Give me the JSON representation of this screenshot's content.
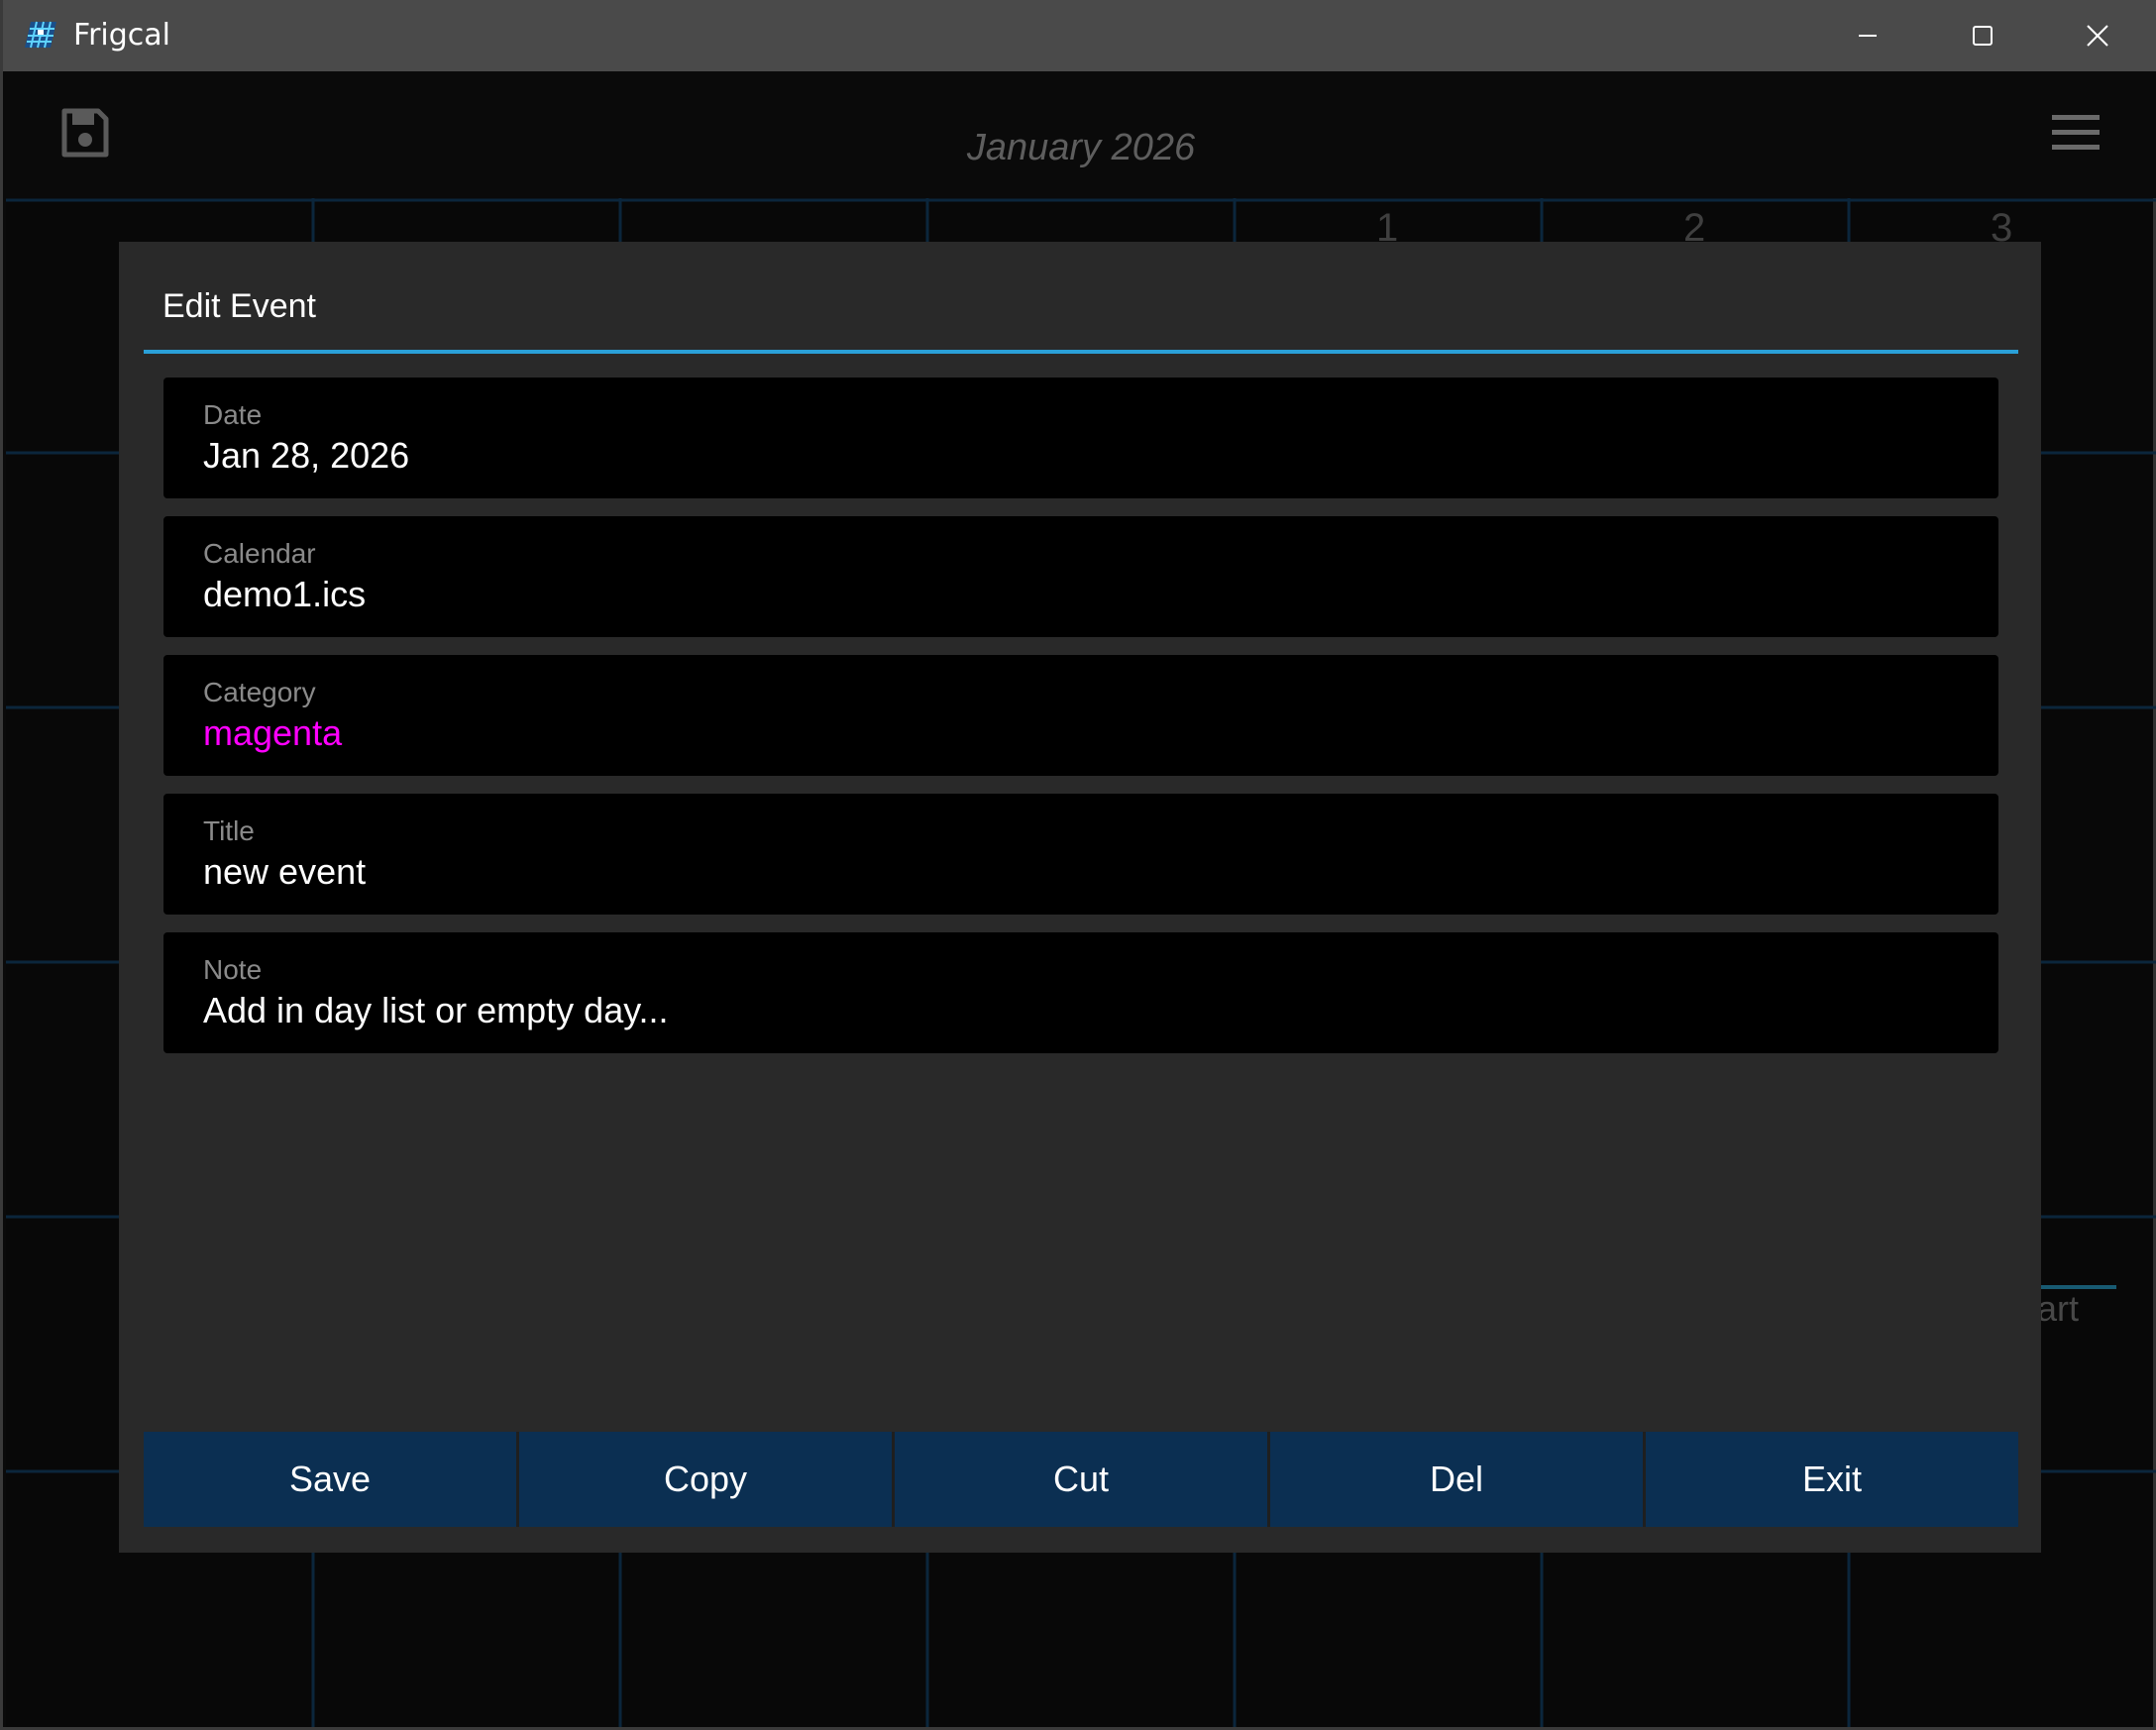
{
  "window": {
    "title": "Frigcal",
    "app_icon": "frigcal-calendar-icon",
    "controls": [
      "minimize-icon",
      "maximize-icon",
      "close-icon"
    ]
  },
  "toolbar": {
    "save_icon": "floppy-disk-icon",
    "month_title": "January 2026",
    "menu_icon": "hamburger-menu-icon"
  },
  "calendar": {
    "visible_day_numbers": [
      "1",
      "2",
      "3"
    ],
    "partial_text": "tart"
  },
  "dialog": {
    "title": "Edit Event",
    "fields": [
      {
        "label": "Date",
        "value": "Jan 28, 2026"
      },
      {
        "label": "Calendar",
        "value": "demo1.ics"
      },
      {
        "label": "Category",
        "value": "magenta"
      },
      {
        "label": "Title",
        "value": "new event"
      },
      {
        "label": "Note",
        "value": "Add in day list or empty day..."
      }
    ],
    "buttons": [
      "Save",
      "Copy",
      "Cut",
      "Del",
      "Exit"
    ]
  },
  "colors": {
    "accent": "#2aa0d8",
    "button_bg": "#0b2f52",
    "category_magenta": "#ff00ff",
    "dialog_bg": "#292929",
    "field_bg": "#000000",
    "grid_line": "#0e2d47"
  }
}
